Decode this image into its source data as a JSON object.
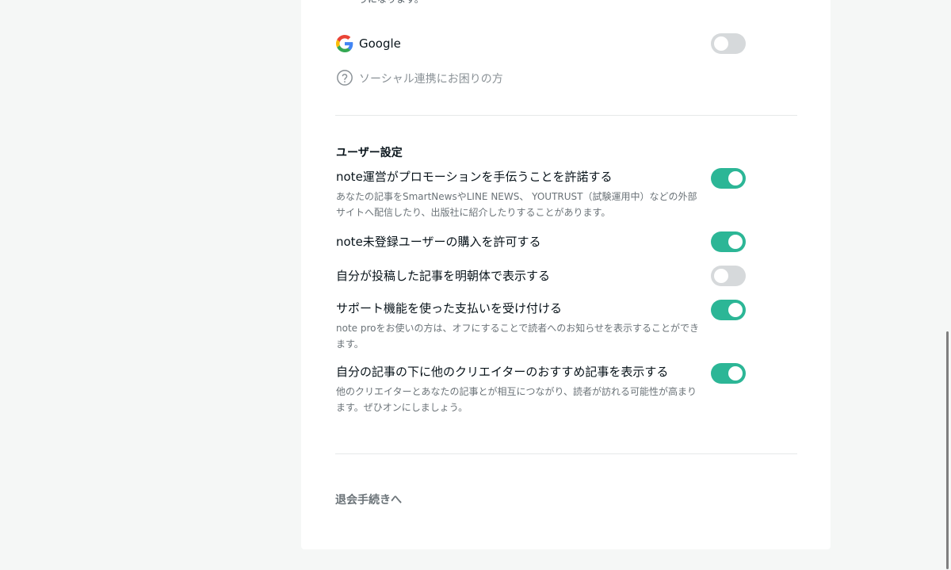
{
  "social": {
    "cut_text": "うになります。",
    "google_label": "Google",
    "google_enabled": false,
    "help_label": "ソーシャル連携にお困りの方"
  },
  "user_settings": {
    "title": "ユーザー設定",
    "items": [
      {
        "label": "note運営がプロモーションを手伝うことを許諾する",
        "desc": "あなたの記事をSmartNewsやLINE NEWS、 YOUTRUST（試験運用中）などの外部サイトへ配信したり、出版社に紹介したりすることがあります。",
        "enabled": true
      },
      {
        "label": "note未登録ユーザーの購入を許可する",
        "desc": "",
        "enabled": true
      },
      {
        "label": "自分が投稿した記事を明朝体で表示する",
        "desc": "",
        "enabled": false
      },
      {
        "label": "サポート機能を使った支払いを受け付ける",
        "desc": "note proをお使いの方は、オフにすることで読者へのお知らせを表示することができます。",
        "enabled": true
      },
      {
        "label": "自分の記事の下に他のクリエイターのおすすめ記事を表示する",
        "desc": "他のクリエイターとあなたの記事とが相互につながり、読者が訪れる可能性が高まります。ぜひオンにしましょう。",
        "enabled": true
      }
    ]
  },
  "footer": {
    "withdraw_label": "退会手続きへ"
  },
  "colors": {
    "toggle_on": "#2cb696",
    "toggle_off": "#d6d9db"
  },
  "icons": {
    "google": "google-g-icon",
    "help": "question-circle-icon"
  }
}
